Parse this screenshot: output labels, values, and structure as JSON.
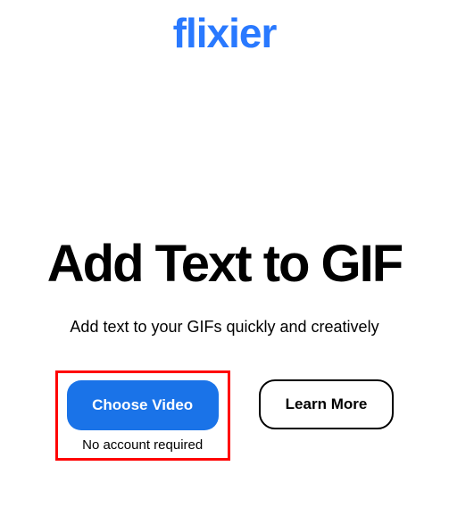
{
  "brand": {
    "name": "flixier",
    "color": "#2979ff"
  },
  "hero": {
    "title": "Add Text to GIF",
    "subtitle": "Add text to your GIFs quickly and creatively"
  },
  "cta": {
    "primary_label": "Choose Video",
    "secondary_label": "Learn More",
    "note": "No account required"
  },
  "highlight": {
    "color": "#ff0000"
  }
}
